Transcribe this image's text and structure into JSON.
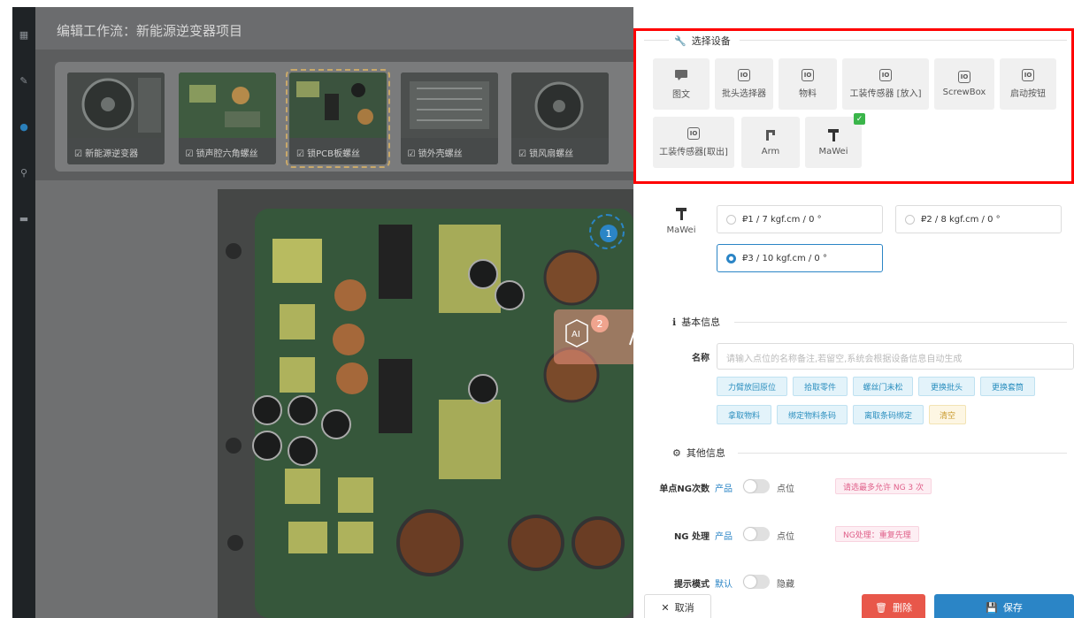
{
  "window": {
    "title": "编辑工作流：新能源逆变器项目"
  },
  "sidebar": {
    "icons": [
      "grid-icon",
      "wrench-icon",
      "dot-icon",
      "search-icon",
      "chat-icon"
    ]
  },
  "thumbnails": [
    {
      "label": "新能源逆变器",
      "selected": false
    },
    {
      "label": "锁声腔六角螺丝",
      "selected": false
    },
    {
      "label": "锁PCB板螺丝",
      "selected": true
    },
    {
      "label": "锁外壳螺丝",
      "selected": false
    },
    {
      "label": "锁风扇螺丝",
      "selected": false
    }
  ],
  "canvas": {
    "markers": [
      "1",
      "2"
    ],
    "ai_label": "AI"
  },
  "select_device": {
    "title": "选择设备",
    "devices": [
      {
        "label": "图文",
        "icon": "text-image-icon"
      },
      {
        "label": "批头选择器",
        "icon": "io-icon"
      },
      {
        "label": "物料",
        "icon": "io-icon"
      },
      {
        "label": "工装传感器 [放入]",
        "icon": "io-icon"
      },
      {
        "label": "ScrewBox",
        "icon": "io-icon"
      },
      {
        "label": "启动按钮",
        "icon": "io-icon"
      },
      {
        "label": "工装传感器[取出]",
        "icon": "io-icon"
      },
      {
        "label": "Arm",
        "icon": "arm-icon"
      },
      {
        "label": "MaWei",
        "icon": "screwdriver-icon",
        "checked": true
      }
    ]
  },
  "mawei": {
    "label": "MaWei",
    "options": [
      {
        "text": "₽1 / 7 kgf.cm / 0 °",
        "selected": false
      },
      {
        "text": "₽2 / 8 kgf.cm / 0 °",
        "selected": false
      },
      {
        "text": "₽3 / 10 kgf.cm / 0 °",
        "selected": true
      }
    ]
  },
  "basic_info": {
    "title": "基本信息",
    "name_label": "名称",
    "name_placeholder": "请输入点位的名称备注,若留空,系统会根据设备信息自动生成",
    "tags": [
      "力臂放回原位",
      "拾取零件",
      "螺丝门未松",
      "更换批头",
      "更换套筒",
      "拿取物料",
      "绑定物料条码",
      "离取条码绑定",
      "清空"
    ]
  },
  "other_info": {
    "title": "其他信息",
    "rows": [
      {
        "label": "单点NG次数",
        "left": "产品",
        "right": "点位",
        "note": "请选最多允许 NG 3 次"
      },
      {
        "label": "NG 处理",
        "left": "产品",
        "right": "点位",
        "note": "NG处理：重复先理"
      },
      {
        "label": "提示模式",
        "left": "默认",
        "right": "隐藏",
        "note": ""
      }
    ]
  },
  "footer": {
    "cancel": "取消",
    "delete": "删除",
    "save": "保存"
  },
  "colors": {
    "accent": "#2b85c6",
    "danger": "#e8574a",
    "highlight": "#ff0000"
  }
}
